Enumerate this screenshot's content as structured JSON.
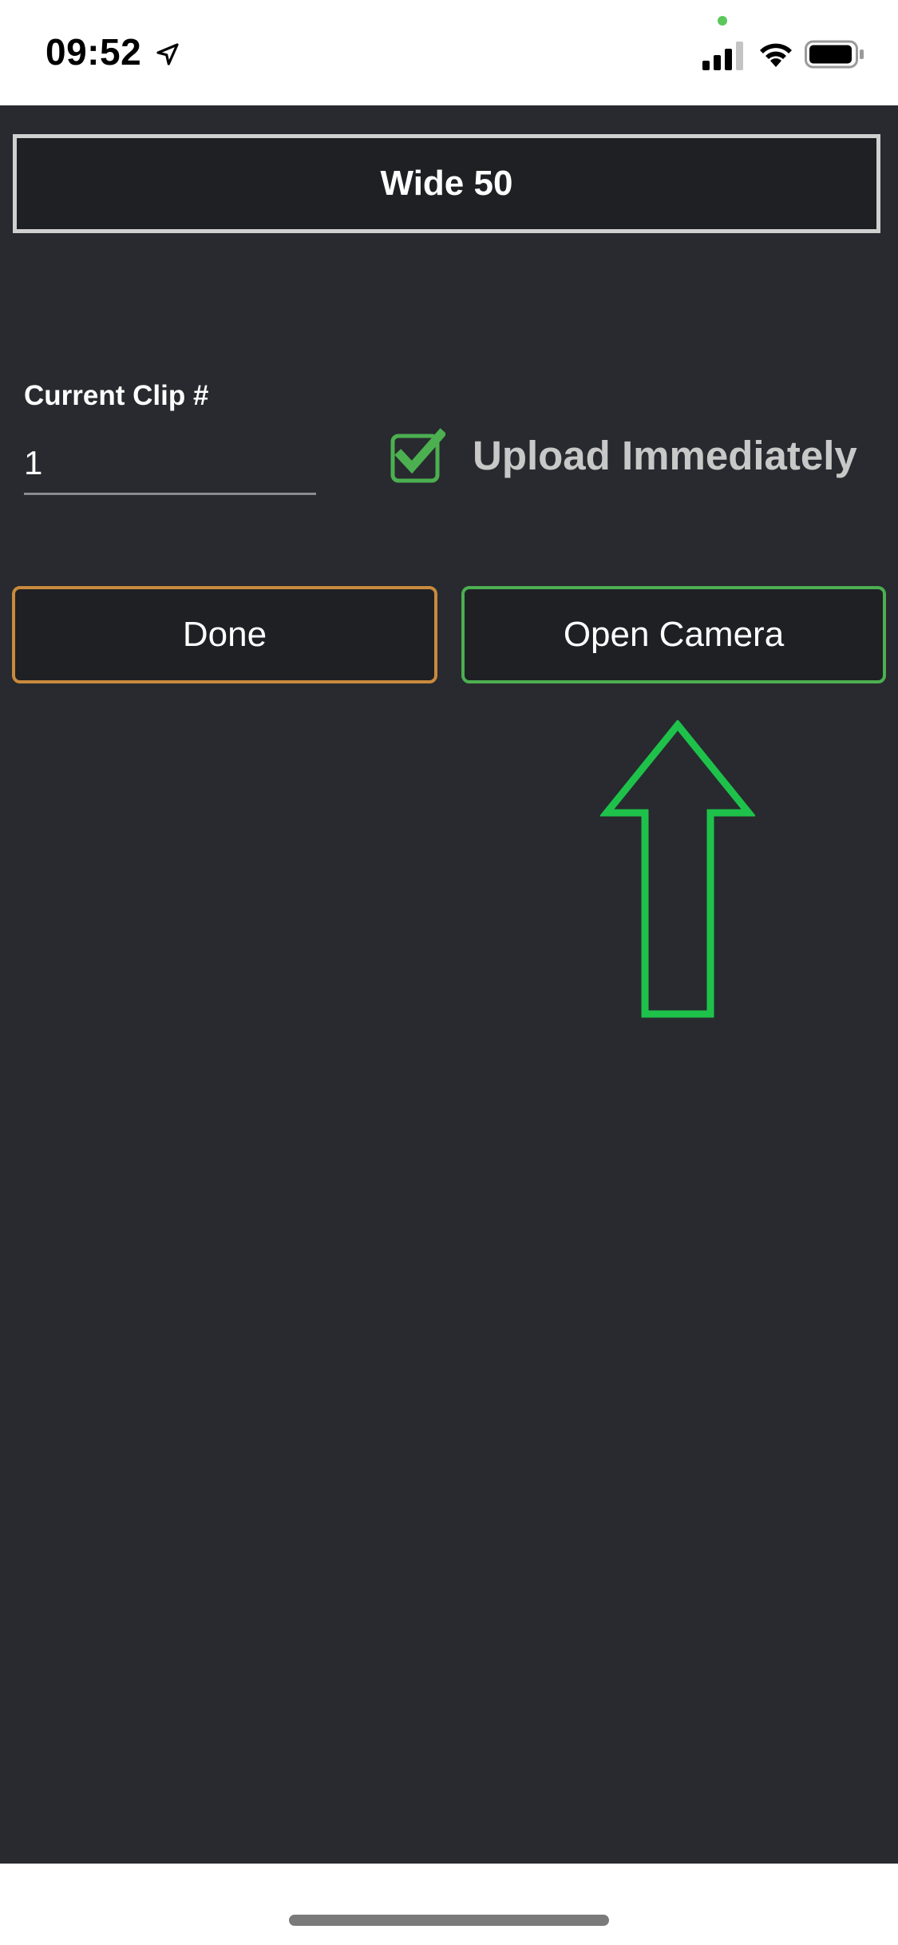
{
  "status_bar": {
    "time": "09:52",
    "icons": [
      "location-arrow-icon",
      "cellular-signal-icon",
      "wifi-icon",
      "battery-icon"
    ],
    "privacy_indicator_color": "#5ac85a"
  },
  "header": {
    "title": "Wide 50"
  },
  "clip": {
    "label": "Current Clip #",
    "value": "1"
  },
  "upload": {
    "label": "Upload Immediately",
    "checked": true,
    "check_color": "#4caf50"
  },
  "buttons": {
    "done_label": "Done",
    "open_camera_label": "Open Camera"
  },
  "annotation": {
    "icon": "up-arrow-icon",
    "color": "#1ec24a"
  },
  "colors": {
    "background": "#282a2f",
    "button_bg": "#1f2024",
    "done_border": "#c88a3c",
    "camera_border": "#4caf50",
    "title_border": "#d0d0d0"
  }
}
